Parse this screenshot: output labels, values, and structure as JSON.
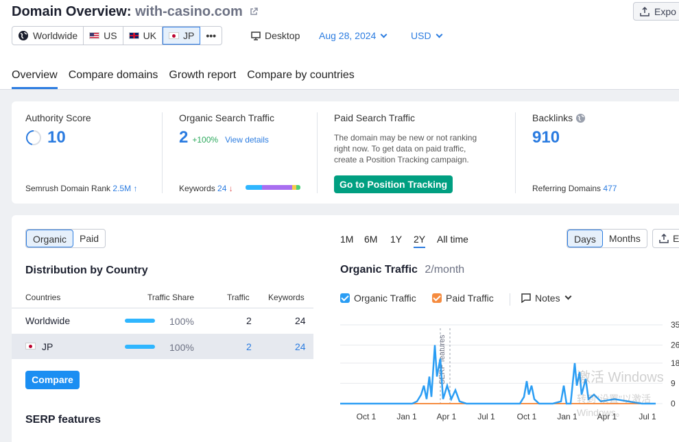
{
  "header": {
    "title": "Domain Overview:",
    "domain": "with-casino.com",
    "export_label": "Expo"
  },
  "databases": [
    {
      "label": "Worldwide",
      "icon": "globe-icon"
    },
    {
      "label": "US",
      "icon": "us-flag"
    },
    {
      "label": "UK",
      "icon": "uk-flag"
    },
    {
      "label": "JP",
      "icon": "jp-flag",
      "active": true
    },
    {
      "label": "•••"
    }
  ],
  "device": "Desktop",
  "date": "Aug 28, 2024",
  "currency": "USD",
  "tabs": [
    "Overview",
    "Compare domains",
    "Growth report",
    "Compare by countries"
  ],
  "metrics": {
    "authority_label": "Authority Score",
    "authority_value": "10",
    "rank_label": "Semrush Domain Rank",
    "rank_value": "2.5M",
    "organic_label": "Organic Search Traffic",
    "organic_value": "2",
    "organic_change": "+100%",
    "view_details": "View details",
    "keywords_label": "Keywords",
    "keywords_value": "24",
    "paid_label": "Paid Search Traffic",
    "paid_text_1": "The domain may be new or not ranking",
    "paid_text_2": "right now. To get data on paid traffic,",
    "paid_text_3": "create a Position Tracking campaign.",
    "position_tracking_btn": "Go to Position Tracking",
    "backlinks_label": "Backlinks",
    "backlinks_value": "910",
    "ref_domains_label": "Referring Domains",
    "ref_domains_value": "477"
  },
  "left_panel": {
    "seg_organic": "Organic",
    "seg_paid": "Paid",
    "distribution_title": "Distribution by Country",
    "columns": [
      "Countries",
      "Traffic Share",
      "Traffic",
      "Keywords"
    ],
    "rows": [
      {
        "country": "Worldwide",
        "share": "100%",
        "traffic": "2",
        "keywords": "24"
      },
      {
        "country": "JP",
        "share": "100%",
        "traffic": "2",
        "keywords": "24"
      }
    ],
    "compare_btn": "Compare",
    "serp_title": "SERP features"
  },
  "right_panel": {
    "periods": [
      "1M",
      "6M",
      "1Y",
      "2Y",
      "All time"
    ],
    "active_period": "2Y",
    "days": "Days",
    "months": "Months",
    "export_short": "E",
    "chart_title": "Organic Traffic",
    "chart_subtitle": "2/month",
    "legend_organic": "Organic Traffic",
    "legend_paid": "Paid Traffic",
    "notes": "Notes",
    "serp_annotation": "SERP features",
    "colors": {
      "organic": "#2a9df4",
      "paid": "#f58b3f",
      "accent": "#2a7be0",
      "green_btn": "#009f81"
    }
  },
  "chart_data": {
    "type": "line",
    "x_ticks": [
      "Oct 1",
      "Jan 1",
      "Apr 1",
      "Jul 1",
      "Oct 1",
      "Jan 1",
      "Apr 1",
      "Jul 1"
    ],
    "y_ticks": [
      "0",
      "9",
      "18",
      "26",
      "35"
    ],
    "ylim": [
      0,
      35
    ],
    "series": [
      {
        "name": "Organic Traffic",
        "points": [
          [
            0,
            0
          ],
          [
            90,
            0
          ],
          [
            105,
            0
          ],
          [
            112,
            1
          ],
          [
            118,
            4
          ],
          [
            122,
            8
          ],
          [
            126,
            2
          ],
          [
            130,
            12
          ],
          [
            133,
            3
          ],
          [
            138,
            26
          ],
          [
            141,
            12
          ],
          [
            146,
            20
          ],
          [
            150,
            2
          ],
          [
            156,
            8
          ],
          [
            162,
            2
          ],
          [
            168,
            6
          ],
          [
            174,
            1
          ],
          [
            184,
            0
          ],
          [
            220,
            0
          ],
          [
            230,
            0
          ],
          [
            245,
            0
          ],
          [
            252,
            0
          ],
          [
            262,
            0
          ],
          [
            268,
            3
          ],
          [
            272,
            10
          ],
          [
            275,
            4
          ],
          [
            279,
            8
          ],
          [
            283,
            2
          ],
          [
            290,
            0
          ],
          [
            310,
            0
          ],
          [
            322,
            1
          ],
          [
            326,
            8
          ],
          [
            330,
            0
          ],
          [
            336,
            0
          ],
          [
            342,
            18
          ],
          [
            345,
            8
          ],
          [
            349,
            14
          ],
          [
            352,
            4
          ],
          [
            358,
            11
          ],
          [
            362,
            2
          ],
          [
            370,
            4
          ],
          [
            380,
            1
          ],
          [
            400,
            2
          ],
          [
            420,
            1
          ],
          [
            440,
            0
          ],
          [
            460,
            0
          ]
        ]
      },
      {
        "name": "Paid Traffic",
        "points": [
          [
            0,
            0
          ],
          [
            460,
            0
          ]
        ]
      }
    ]
  },
  "watermark": {
    "line1": "激活 Windows",
    "line2": "转到\"设置\"以激活 Windows。"
  }
}
